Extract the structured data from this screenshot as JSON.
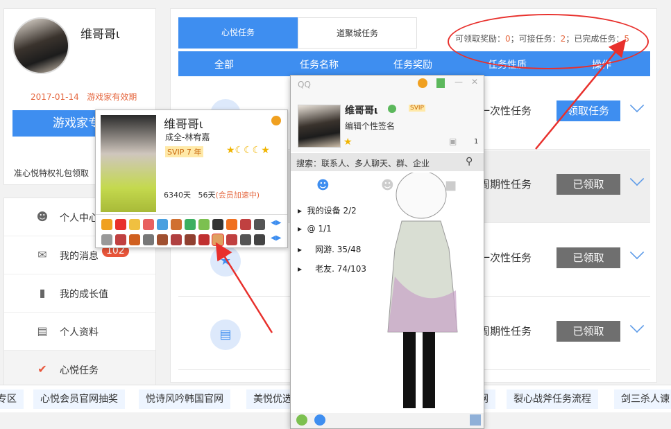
{
  "profile": {
    "username": "维哥哥ι",
    "expiry_date": "2017-01-14",
    "expiry_label": "游戏家有效期",
    "vip_button": "游戏家专",
    "gift_text": "准心悦特权礼包领取"
  },
  "nav": {
    "items": [
      {
        "label": "个人中心",
        "icon": "user-icon"
      },
      {
        "label": "我的消息",
        "icon": "mail-icon",
        "badge": "102"
      },
      {
        "label": "我的成长值",
        "icon": "bar-chart-icon"
      },
      {
        "label": "个人资料",
        "icon": "id-card-icon"
      },
      {
        "label": "心悦任务",
        "icon": "check-circle-icon",
        "active": true
      }
    ]
  },
  "main": {
    "tabs": [
      "心悦任务",
      "道聚城任务"
    ],
    "stats": {
      "claimable_label": "可领取奖励：",
      "claimable": "0",
      "acceptable_label": "；可接任务：",
      "acceptable": "2",
      "completed_label": "；已完成任务：",
      "completed": "5"
    },
    "columns": [
      "全部",
      "任务名称",
      "任务奖励",
      "任务性质",
      "操作"
    ],
    "rows": [
      {
        "type": "一次性任务",
        "action": "领取任务",
        "style": "blue"
      },
      {
        "type": "周期性任务",
        "action": "已领取",
        "style": "gray"
      },
      {
        "type": "一次性任务",
        "action": "已领取",
        "style": "gray"
      },
      {
        "type": "周期性任务",
        "action": "已领取",
        "style": "gray"
      }
    ]
  },
  "bottom_links": [
    "专区",
    "心悦会员官网抽奖",
    "悦诗风吟韩国官网",
    "美悦优选",
    "网",
    "裂心战斧任务流程",
    "剑三杀人谏"
  ],
  "friend_popup": {
    "name": "维哥哥ι",
    "remark": "成全-林宥嘉",
    "vip": "SVIP 7 年",
    "days_active": "6340天",
    "days_member": "56天",
    "accel": "(会员加速中)"
  },
  "qq_panel": {
    "logo": "QQ",
    "name": "维哥哥ι",
    "signature": "编辑个性签名",
    "search_placeholder": "搜索：联系人、多人聊天、群、企业",
    "shirt_count": "1",
    "groups": [
      {
        "name": "我的设备",
        "count": "2/2"
      },
      {
        "name": "@",
        "count": "1/1"
      },
      {
        "name": "网游.",
        "count": "35/48"
      },
      {
        "name": "老友.",
        "count": "74/103"
      }
    ]
  },
  "colors": {
    "accent": "#3e8ef0",
    "orange": "#e5673f",
    "annotation": "#e8302c"
  }
}
